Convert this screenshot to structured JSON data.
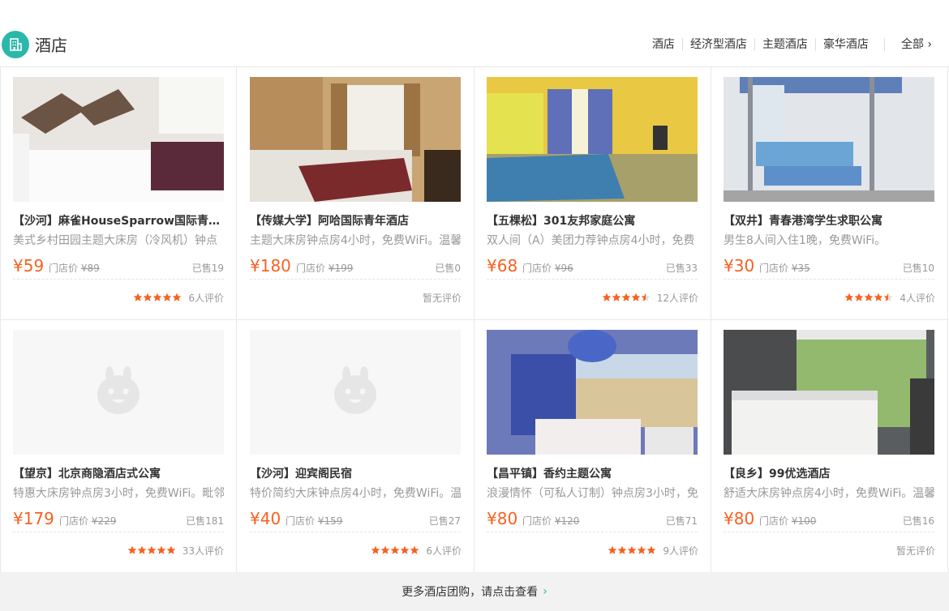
{
  "header": {
    "title": "酒店",
    "icon": "hotel-building-icon",
    "accent": "#2bb8aa",
    "filters": [
      "酒店",
      "经济型酒店",
      "主题酒店",
      "豪华酒店"
    ],
    "all_label": "全部 ›"
  },
  "labels": {
    "store_price": "门店价"
  },
  "cards": [
    {
      "title": "【沙河】麻雀HouseSparrow国际青年旅舍",
      "desc": "美式乡村田园主题大床房（冷风机）钟点",
      "price": "¥59",
      "orig": "¥89",
      "sold": "已售19",
      "rating_text": "6人评价",
      "stars": 5
    },
    {
      "title": "【传媒大学】阿哈国际青年酒店",
      "desc": "主题大床房钟点房4小时，免费WiFi。温馨",
      "price": "¥180",
      "orig": "¥199",
      "sold": "已售0",
      "rating_text": "暂无评价",
      "stars": 0
    },
    {
      "title": "【五棵松】301友邦家庭公寓",
      "desc": "双人间（A）美团力荐钟点房4小时，免费",
      "price": "¥68",
      "orig": "¥96",
      "sold": "已售33",
      "rating_text": "12人评价",
      "stars": 4.5
    },
    {
      "title": "【双井】青春港湾学生求职公寓",
      "desc": "男生8人间入住1晚，免费WiFi。",
      "price": "¥30",
      "orig": "¥35",
      "sold": "已售10",
      "rating_text": "4人评价",
      "stars": 4.5
    },
    {
      "title": "【望京】北京商隐酒店式公寓",
      "desc": "特惠大床房钟点房3小时，免费WiFi。毗邻",
      "price": "¥179",
      "orig": "¥229",
      "sold": "已售181",
      "rating_text": "33人评价",
      "stars": 5
    },
    {
      "title": "【沙河】迎宾阁民宿",
      "desc": "特价简约大床钟点房4小时，免费WiFi。温",
      "price": "¥40",
      "orig": "¥159",
      "sold": "已售27",
      "rating_text": "6人评价",
      "stars": 5
    },
    {
      "title": "【昌平镇】香约主题公寓",
      "desc": "浪漫情怀（可私人订制）钟点房3小时，免",
      "price": "¥80",
      "orig": "¥120",
      "sold": "已售71",
      "rating_text": "9人评价",
      "stars": 5
    },
    {
      "title": "【良乡】99优选酒店",
      "desc": "舒适大床房钟点房4小时，免费WiFi。温馨",
      "price": "¥80",
      "orig": "¥100",
      "sold": "已售16",
      "rating_text": "暂无评价",
      "stars": 0
    }
  ],
  "footer": {
    "text": "更多酒店团购，请点击查看",
    "chevron": "›"
  },
  "colors": {
    "price": "#f76120",
    "muted": "#999999",
    "border": "#e8e8e8"
  }
}
